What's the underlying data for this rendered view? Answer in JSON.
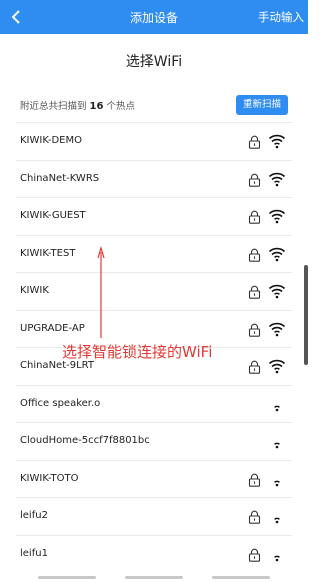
{
  "header": {
    "title": "添加设备",
    "manual_label": "手动输入"
  },
  "page_title": "选择WiFi",
  "scan": {
    "prefix": "附近总共扫描到",
    "count": "16",
    "suffix": "个热点",
    "rescan_label": "重新扫描"
  },
  "wifi_list": [
    {
      "ssid": "KIWIK-DEMO",
      "locked": true
    },
    {
      "ssid": "ChinaNet-KWRS",
      "locked": true
    },
    {
      "ssid": "KIWIK-GUEST",
      "locked": true
    },
    {
      "ssid": "KIWIK-TEST",
      "locked": true
    },
    {
      "ssid": "KIWIK",
      "locked": true
    },
    {
      "ssid": "UPGRADE-AP",
      "locked": true
    },
    {
      "ssid": "ChinaNet-9LRT",
      "locked": true
    },
    {
      "ssid": "Office speaker.o",
      "locked": false
    },
    {
      "ssid": "CloudHome-5ccf7f8801bc",
      "locked": false
    },
    {
      "ssid": "KIWIK-TOTO",
      "locked": true
    },
    {
      "ssid": "leifu2",
      "locked": true
    },
    {
      "ssid": "leifu1",
      "locked": true
    }
  ],
  "annotation": {
    "text": "选择智能锁连接的WiFi",
    "color": "#e53935"
  },
  "colors": {
    "accent": "#2f8cf0"
  }
}
